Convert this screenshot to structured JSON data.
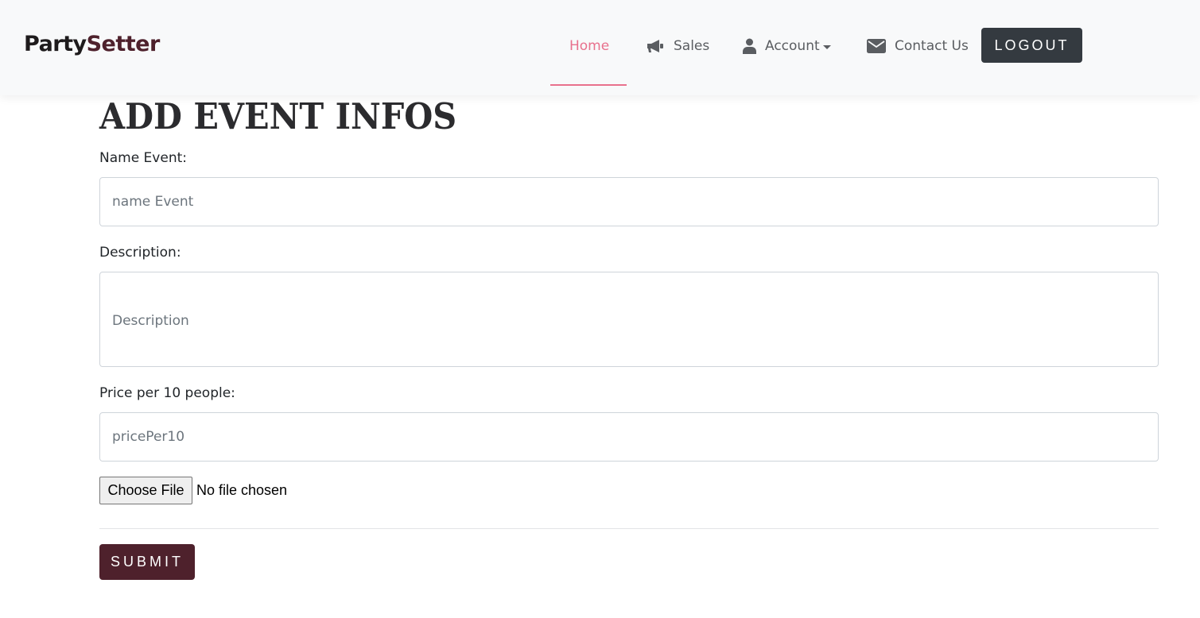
{
  "navbar": {
    "brand_main": "Party",
    "brand_accent": "Setter",
    "items": [
      {
        "label": "Home",
        "icon": null,
        "active": true
      },
      {
        "label": "Sales",
        "icon": "megaphone-icon"
      },
      {
        "label": "Account",
        "icon": "user-icon",
        "dropdown": true
      },
      {
        "label": "Contact Us",
        "icon": "envelope-icon"
      }
    ],
    "logout_label": "LOGOUT",
    "active_color": "#e8718d",
    "logout_bg": "#343a40"
  },
  "form": {
    "title": "ADD EVENT INFOS",
    "name_label": "Name Event:",
    "name_placeholder": "name Event",
    "name_value": "",
    "description_label": "Description:",
    "description_placeholder": "Description",
    "description_value": "",
    "price_label": "Price per 10 people:",
    "price_placeholder": "pricePer10",
    "price_value": "",
    "file_button_label": "Choose File",
    "file_status": "No file chosen",
    "submit_label": "SUBMIT",
    "submit_bg": "#4e212c"
  }
}
